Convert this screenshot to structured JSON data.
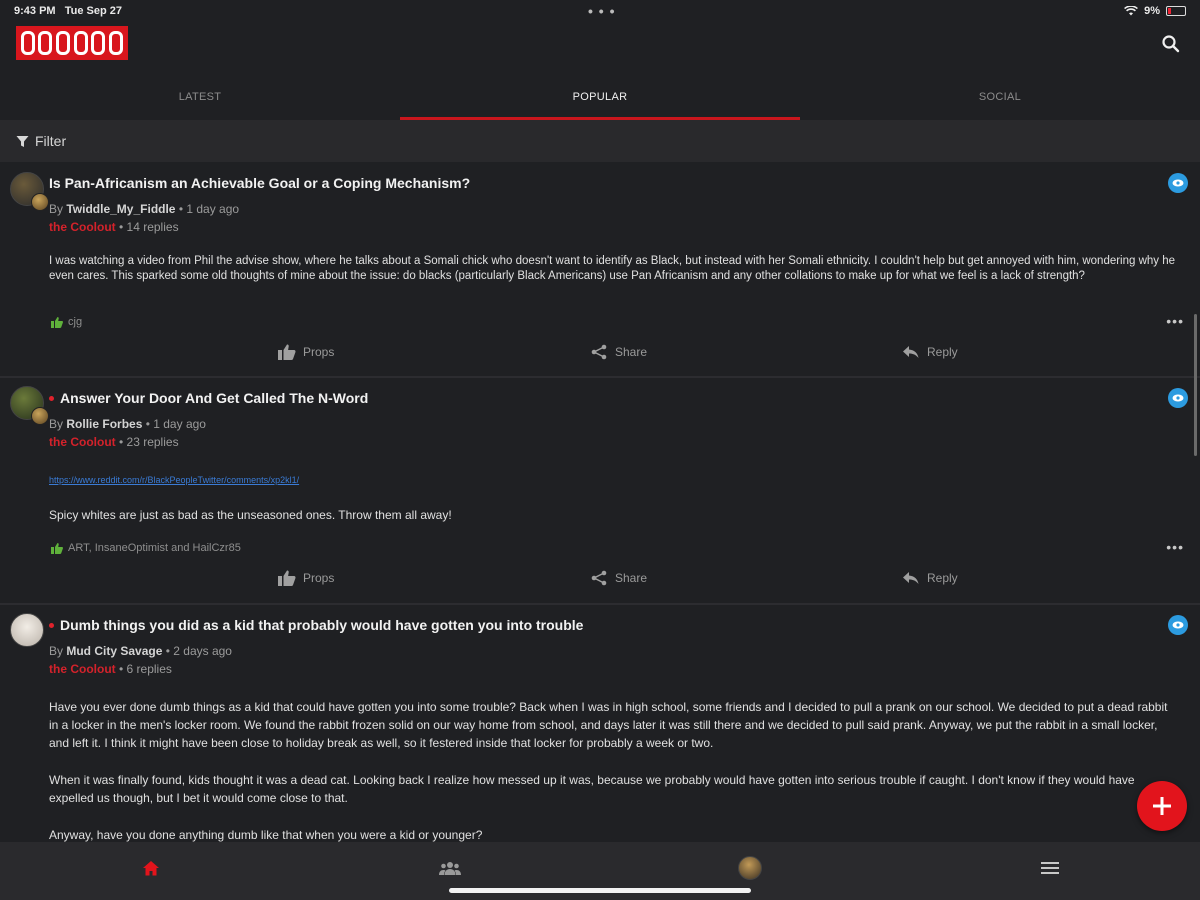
{
  "status": {
    "time": "9:43 PM",
    "date": "Tue Sep 27",
    "battery": "9%"
  },
  "colors": {
    "brand": "#d8161d",
    "background": "#1f2023",
    "badge": "#2c9be0",
    "props_green": "#5fb13b"
  },
  "icons": {
    "search": "search-icon",
    "filter": "filter-icon",
    "props": "thumbs-up-icon",
    "share": "share-icon",
    "reply": "reply-icon",
    "home": "home-icon",
    "groups": "groups-icon",
    "menu": "hamburger-menu-icon",
    "add": "plus-icon"
  },
  "tabs": [
    {
      "label": "LATEST"
    },
    {
      "label": "POPULAR"
    },
    {
      "label": "SOCIAL"
    }
  ],
  "filter": {
    "label": "Filter"
  },
  "posts": [
    {
      "title": "Is Pan-Africanism an Achievable Goal or a Coping Mechanism?",
      "by_label": "By",
      "author": "Twiddle_My_Fiddle",
      "age": "• 1 day ago",
      "group": "the Coolout",
      "replies": "• 14 replies",
      "body": "I was watching a video from Phil the advise show, where he talks about a Somali chick who doesn't want to identify as Black, but instead with her Somali ethnicity. I couldn't help but get annoyed with him, wondering why he even cares. This sparked some old thoughts of mine about the issue: do blacks (particularly Black Americans) use Pan Africanism and any other collations to make up for what we feel is a lack of strength?",
      "props_by": "cjg",
      "actions": {
        "props": "Props",
        "share": "Share",
        "reply": "Reply"
      }
    },
    {
      "title": "Answer Your Door And Get Called The N-Word",
      "by_label": "By",
      "author": "Rollie Forbes",
      "age": "• 1 day ago",
      "group": "the Coolout",
      "replies": "• 23 replies",
      "link": "https://www.reddit.com/r/BlackPeopleTwitter/comments/xp2kl1/",
      "body": "Spicy whites are just as bad as the unseasoned ones. Throw them all away!",
      "props_by": "ART, InsaneOptimist and HailCzr85",
      "actions": {
        "props": "Props",
        "share": "Share",
        "reply": "Reply"
      }
    },
    {
      "title": "Dumb things you did as a kid that probably would have gotten you into trouble",
      "by_label": "By",
      "author": "Mud City Savage",
      "age": "• 2 days ago",
      "group": "the Coolout",
      "replies": "• 6 replies",
      "body_p1": "Have you ever done dumb things as a kid that could have gotten you into some trouble? Back when I was in high school, some friends and I decided to pull a prank on our school. We decided to put a dead rabbit in a locker in the men's locker room. We found the rabbit frozen solid on our way home from school, and days later it was still there and we decided to pull said prank. Anyway, we put the rabbit in a small locker, and left it. I think it might have been close to holiday break as well, so it festered inside that locker for probably a week or two.",
      "body_p2": "When it was finally found, kids thought it was a dead cat. Looking back I realize how messed up it was, because we probably would have gotten into serious trouble if caught. I don't know if they would have expelled us though, but I bet it would come close to that.",
      "body_p3": "Anyway, have you done anything dumb like that when you were a kid or younger?"
    }
  ]
}
